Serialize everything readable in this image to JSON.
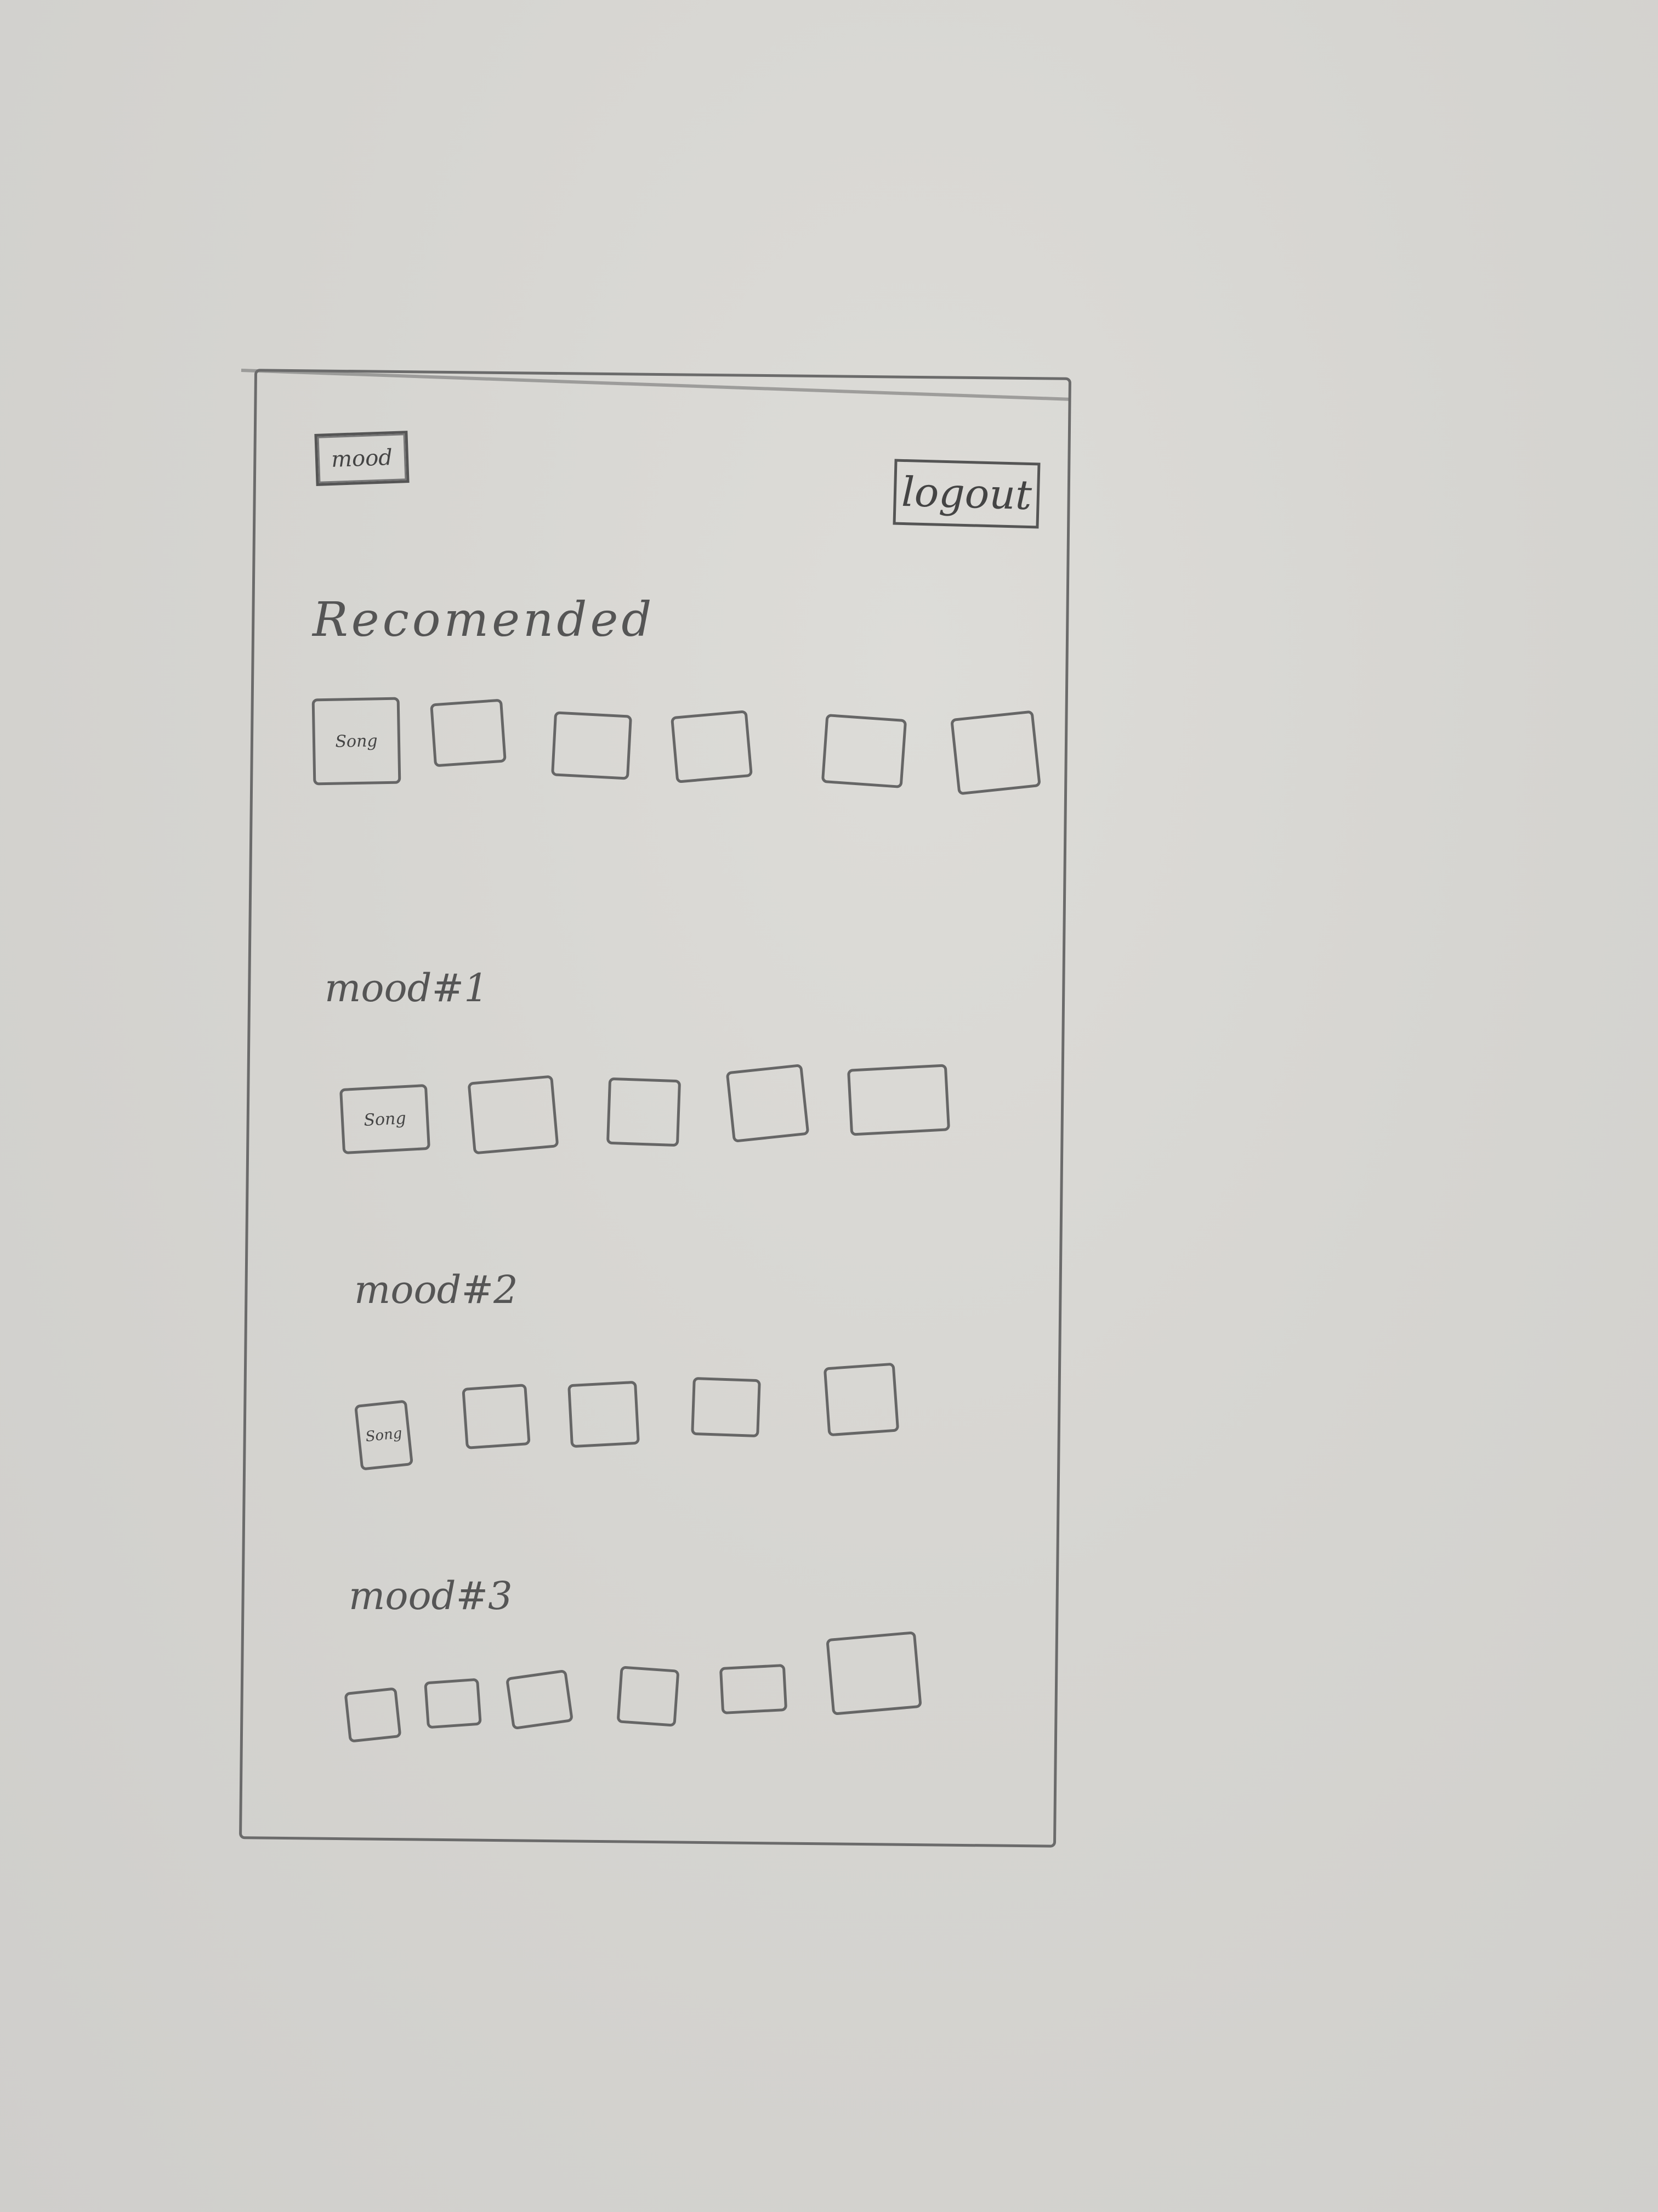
{
  "header": {
    "mood_label": "mood",
    "logout_label": "logout"
  },
  "sections": [
    {
      "title": "Recomended",
      "tiles": [
        "Song",
        "",
        "",
        "",
        "",
        ""
      ]
    },
    {
      "title": "mood#1",
      "tiles": [
        "Song",
        "",
        "",
        "",
        ""
      ]
    },
    {
      "title": "mood#2",
      "tiles": [
        "Song",
        "",
        "",
        "",
        ""
      ]
    },
    {
      "title": "mood#3",
      "tiles": [
        "",
        "",
        "",
        "",
        "",
        ""
      ]
    }
  ]
}
